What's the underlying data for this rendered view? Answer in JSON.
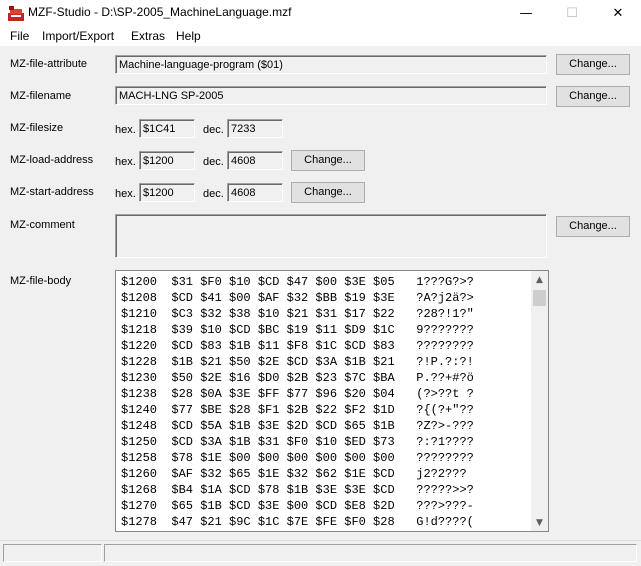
{
  "window": {
    "title": "MZF-Studio - D:\\SP-2005_MachineLanguage.mzf",
    "minimize": "—",
    "maximize": "☐",
    "close": "✕"
  },
  "menu": [
    "File",
    "Import/Export",
    "Extras",
    "Help"
  ],
  "attribute": {
    "label": "MZ-file-attribute",
    "value": "Machine-language-program ($01)",
    "button": "Change..."
  },
  "filename": {
    "label": "MZ-filename",
    "value": "MACH-LNG SP-2005",
    "button": "Change..."
  },
  "filesize": {
    "label": "MZ-filesize",
    "hex_label": "hex.",
    "hex": "$1C41",
    "dec_label": "dec.",
    "dec": "7233"
  },
  "load_address": {
    "label": "MZ-load-address",
    "hex_label": "hex.",
    "hex": "$1200",
    "dec_label": "dec.",
    "dec": "4608",
    "button": "Change..."
  },
  "start_address": {
    "label": "MZ-start-address",
    "hex_label": "hex.",
    "hex": "$1200",
    "dec_label": "dec.",
    "dec": "4608",
    "button": "Change..."
  },
  "comment": {
    "label": "MZ-comment",
    "value": "",
    "button": "Change..."
  },
  "file_body": {
    "label": "MZ-file-body",
    "lines": [
      "$1200  $31 $F0 $10 $CD $47 $00 $3E $05   1???G?>?",
      "$1208  $CD $41 $00 $AF $32 $BB $19 $3E   ?A?j2ä?>",
      "$1210  $C3 $32 $38 $10 $21 $31 $17 $22   ?28?!1?\"",
      "$1218  $39 $10 $CD $BC $19 $11 $D9 $1C   9???????",
      "$1220  $CD $83 $1B $11 $F8 $1C $CD $83   ????????",
      "$1228  $1B $21 $50 $2E $CD $3A $1B $21   ?!P.?:?!",
      "$1230  $50 $2E $16 $D0 $2B $23 $7C $BA   P.??+#?ö",
      "$1238  $28 $0A $3E $FF $77 $96 $20 $04   (?>??t ?",
      "$1240  $77 $BE $28 $F1 $2B $22 $F2 $1D   ?{(?+\"??",
      "$1248  $CD $5A $1B $3E $2D $CD $65 $1B   ?Z?>-???",
      "$1250  $CD $3A $1B $31 $F0 $10 $ED $73   ?:?1????",
      "$1258  $78 $1E $00 $00 $00 $00 $00 $00   ????????",
      "$1260  $AF $32 $65 $1E $32 $62 $1E $CD   j2?2???",
      "$1268  $B4 $1A $CD $78 $1B $3E $3E $CD   ?????>>?",
      "$1270  $65 $1B $CD $3E $00 $CD $E8 $2D   ???>???-",
      "$1278  $47 $21 $9C $1C $7E $FE $F0 $28   G!d????("
    ]
  },
  "scrollbar": {
    "up": "▲",
    "down": "▼"
  }
}
